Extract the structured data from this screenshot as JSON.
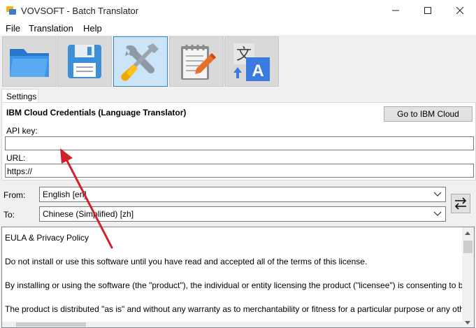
{
  "window": {
    "title": "VOVSOFT - Batch Translator",
    "minimize": "—",
    "maximize": "☐",
    "close": "✕"
  },
  "menu": [
    "File",
    "Translation",
    "Help"
  ],
  "toolbar": {
    "buttons": [
      {
        "name": "open-folder",
        "icon": "folder-icon",
        "active": false
      },
      {
        "name": "save",
        "icon": "floppy-disk-icon",
        "active": false
      },
      {
        "name": "settings",
        "icon": "wrench-screwdriver-icon",
        "active": true
      },
      {
        "name": "notes",
        "icon": "notepad-pencil-icon",
        "active": false
      },
      {
        "name": "translate",
        "icon": "translate-icon",
        "active": false
      }
    ]
  },
  "tabs": [
    "Settings"
  ],
  "settings": {
    "section_title": "IBM Cloud Credentials (Language Translator)",
    "ibm_button": "Go to IBM Cloud",
    "api_key_label": "API key:",
    "api_key_value": "",
    "url_label": "URL:",
    "url_value": "https://"
  },
  "languages": {
    "from_label": "From:",
    "from_value": "English [en]",
    "to_label": "To:",
    "to_value": "Chinese (Simplified) [zh]",
    "swap_icon": "swap-arrows-icon"
  },
  "eula": {
    "lines": [
      "EULA & Privacy Policy",
      "Do not install or use this software until you have read and accepted all of the terms of this license.",
      "By installing or using the software (the \"product\"), the individual or entity licensing the product (\"licensee\") is consenting to be bound by",
      "The product is distributed \"as is\" and without any warranty as to merchantability or fitness for a particular purpose or any other warranty"
    ]
  },
  "colors": {
    "active_tool": "#cce4f7",
    "annotation_arrow": "#d0202a"
  }
}
